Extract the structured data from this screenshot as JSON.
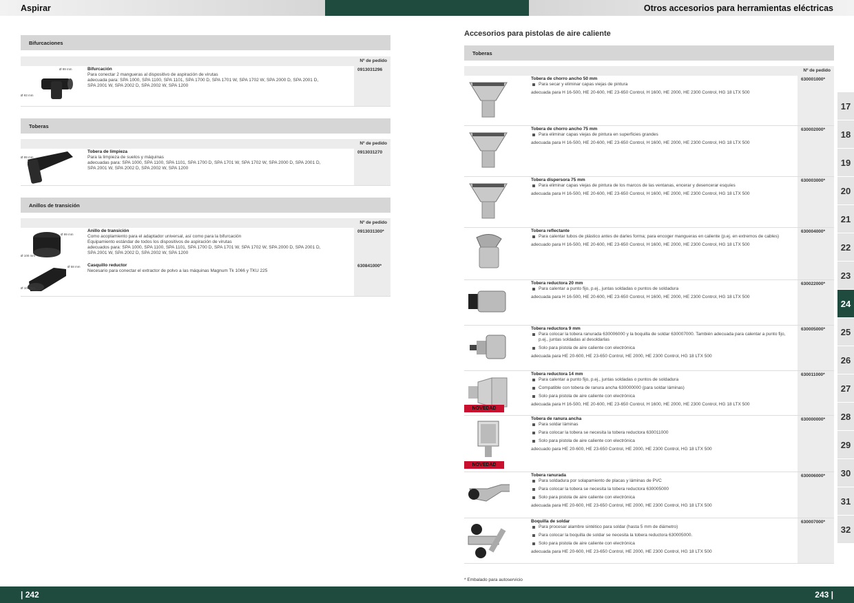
{
  "header": {
    "left_title": "Aspirar",
    "right_title": "Otros accesorios para herramientas eléctricas"
  },
  "footer": {
    "left_page": "| 242",
    "right_page": "243 |"
  },
  "order_header": "Nº de pedido",
  "left": {
    "sections": [
      {
        "title": "Bifurcaciones"
      },
      {
        "title": "Toberas"
      },
      {
        "title": "Anillos de transición"
      }
    ],
    "products": [
      {
        "name": "Bifurcación",
        "lines": [
          "Para conectar 2 mangueras al dispositivo de aspiración de virutas",
          "adecuada para: SPA 1000, SPA 1100, SPA 1101, SPA 1700 D, SPA 1701 W, SPA 1702 W, SPA 2000 D, SPA 2001 D,",
          "SPA 2001 W, SPA 2002 D, SPA 2002 W, SPA 1200"
        ],
        "order": "0913031296",
        "dims": [
          "Ø 99 mm",
          "Ø 93 mm"
        ]
      },
      {
        "name": "Tobera de limpieza",
        "lines": [
          "Para la limpieza de suelos y máquinas",
          "adecuadas para: SPA 1000, SPA 1100, SPA 1101, SPA 1700 D, SPA 1701 W, SPA 1702 W, SPA 2000 D, SPA 2001 D,",
          "SPA 2001 W, SPA 2002 D, SPA 2002 W, SPA 1200"
        ],
        "order": "0913031270",
        "dims": [
          "Ø 99 mm"
        ]
      },
      {
        "name": "Anillo de transición",
        "lines": [
          "Como acoplamiento para el adaptador universal, así como para la bifurcación",
          "Equipamiento estándar de todos los dispositivos de aspiración de virutas",
          "adecuados para: SPA 1000, SPA 1100, SPA 1101, SPA 1700 D, SPA 1701 W, SPA 1702 W, SPA 2000 D, SPA 2001 D,",
          "SPA 2001 W, SPA 2002 D, SPA 2002 W, SPA 1200"
        ],
        "order": "0913031300*",
        "dims": [
          "Ø 99 mm",
          "Ø 100 mm"
        ]
      },
      {
        "name": "Casquillo reductor",
        "lines": [
          "Necesario para conectar el extractor de polvo a las máquinas Magnum Tk 1066 y TKU 225"
        ],
        "order": "630841000*",
        "dims": [
          "Ø 58 mm",
          "Ø 100 mm"
        ]
      }
    ]
  },
  "right": {
    "heading": "Accesorios para pistolas de aire caliente",
    "section": "Toberas",
    "badge": "NOVEDAD",
    "note": "* Embalado para autoservicio",
    "products": [
      {
        "name": "Tobera de chorro ancho 50 mm",
        "bullets": [
          "Para secar y eliminar capas viejas de pintura"
        ],
        "fit": "adecuada para H 16-500, HE 20-600, HE 23-650 Control, H 1600, HE 2000, HE 2300 Control, HG 18 LTX 500",
        "order": "630001000*"
      },
      {
        "name": "Tobera de chorro ancho 75 mm",
        "bullets": [
          "Para eliminar capas viejas de pintura en superficies grandes"
        ],
        "fit": "adecuada para H 16-500, HE 20-600, HE 23-650 Control, H 1600, HE 2000, HE 2300 Control, HG 18 LTX 500",
        "order": "630002000*"
      },
      {
        "name": "Tobera dispersora 75 mm",
        "bullets": [
          "Para eliminar capas viejas de pintura de los marcos de las ventanas, encerar y desencerar esquíes"
        ],
        "fit": "adecuada para H 16-500, HE 20-600, HE 23-650 Control, H 1600, HE 2000, HE 2300 Control, HG 18 LTX 500",
        "order": "630003000*"
      },
      {
        "name": "Tobera reflectante",
        "bullets": [
          "Para calentar tubos de plástico antes de darles forma; para encoger mangueras en caliente (p.ej. en extremos de cables)"
        ],
        "fit": "adecuado para H 16-500, HE 20-600, HE 23-650 Control, H 1600, HE 2000, HE 2300 Control, HG 18 LTX 500",
        "order": "630004000*"
      },
      {
        "name": "Tobera reductora 20 mm",
        "bullets": [
          "Para calentar a punto fijo, p.ej., juntas soldadas o puntos de soldadura"
        ],
        "fit": "adecuada para H 16-500, HE 20-600, HE 23-650 Control, H 1600, HE 2000, HE 2300 Control, HG 18 LTX 500",
        "order": "630022000*"
      },
      {
        "name": "Tobera reductora 9 mm",
        "bullets": [
          "Para colocar la tobera ranurada 630006000 y la boquilla de soldar 630007000. También adecuada para calentar a punto fijo, p.ej., juntas soldadas al desoldarlas",
          "Solo para pistola de aire caliente con electrónica"
        ],
        "fit": "adecuada para HE 20-600, HE 23-650 Control, HE 2000, HE 2300 Control, HG 18 LTX 500",
        "order": "630005000*"
      },
      {
        "name": "Tobera reductora 14 mm",
        "bullets": [
          "Para calentar a punto fijo, p.ej., juntas soldadas o puntos de soldadura",
          "Compatible con tobera de ranura ancha 630000000 (para soldar láminas)",
          "Solo para pistola de aire caliente con electrónica"
        ],
        "fit": "adecuada para H 16-500, HE 20-600, HE 23-650 Control, H 1600, HE 2000, HE 2300 Control, HG 18 LTX 500",
        "order": "630011000*"
      },
      {
        "name": "Tobera de ranura ancha",
        "bullets": [
          "Para soldar láminas",
          "Para colocar la tobera se necesita la tobera reductora 630011000",
          "Solo para pistola de aire caliente con electrónica"
        ],
        "fit": "adecuado para HE 20-600, HE 23-650 Control, HE 2000, HE 2300 Control, HG 18 LTX 500",
        "order": "630000000*"
      },
      {
        "name": "Tobera ranurada",
        "bullets": [
          "Para soldadura por solapamiento de placas y láminas de PVC",
          "Para colocar la tobera se necesita la tobera reductora 630005000",
          "Solo para pistola de aire caliente con electrónica"
        ],
        "fit": "adecuada para HE 20-600, HE 23-650 Control, HE 2000, HE 2300 Control, HG 18 LTX 500",
        "order": "630006000*"
      },
      {
        "name": "Boquilla de soldar",
        "bullets": [
          "Para procesar alambre sintético para soldar (hasta 5 mm de diámetro)",
          "Para colocar la boquilla de soldar se necesita la tobera reductora 630005000.",
          "Solo para pistola de aire caliente con electrónica"
        ],
        "fit": "adecuada para HE 20-600, HE 23-650 Control, HE 2000, HE 2300 Control, HG 18 LTX 500",
        "order": "630007000*"
      }
    ]
  },
  "tabs": {
    "items": [
      "17",
      "18",
      "19",
      "20",
      "21",
      "22",
      "23",
      "24",
      "25",
      "26",
      "27",
      "28",
      "29",
      "30",
      "31",
      "32"
    ],
    "active": "24"
  }
}
